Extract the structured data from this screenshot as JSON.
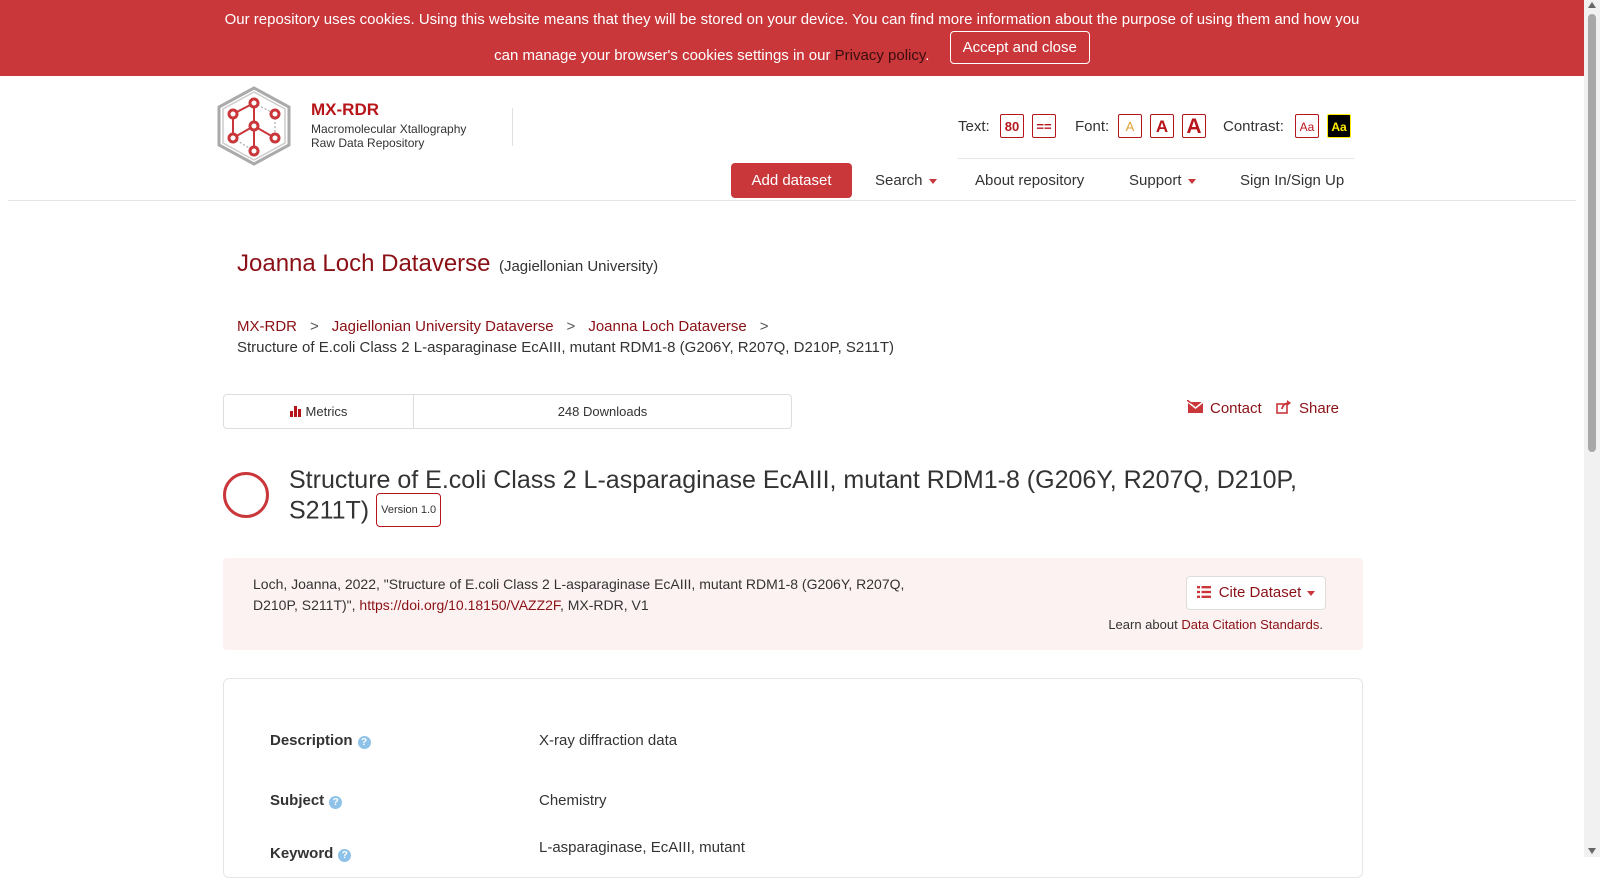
{
  "cookie_banner": {
    "text_line1": "Our repository uses cookies. Using this website means that they will be stored on your device. You can find more information about the purpose of using them and how you",
    "text_line2": "can manage your browser's cookies settings in our",
    "privacy_link": "Privacy policy",
    "period": ".",
    "accept_label": "Accept and close"
  },
  "header": {
    "brand_name": "MX-RDR",
    "brand_sub1": "Macromolecular Xtallography",
    "brand_sub2": "Raw Data Repository"
  },
  "accessibility": {
    "text_label": "Text:",
    "text_btn1": "80",
    "text_btn2": "==",
    "font_label": "Font:",
    "font_btn": "A",
    "contrast_label": "Contrast:",
    "contrast_btn": "Aa"
  },
  "nav": {
    "add_dataset": "Add dataset",
    "search": "Search",
    "about": "About repository",
    "support": "Support",
    "sign_in": "Sign In/Sign Up"
  },
  "dataverse": {
    "name": "Joanna Loch Dataverse",
    "affiliation": "(Jagiellonian University)"
  },
  "breadcrumb": {
    "items": [
      "MX-RDR",
      "Jagiellonian University Dataverse",
      "Joanna Loch Dataverse"
    ],
    "separator": ">",
    "current": "Structure of E.coli Class 2 L-asparaginase EcAIII, mutant RDM1-8 (G206Y, R207Q, D210P, S211T)"
  },
  "metrics": {
    "label": "Metrics",
    "downloads": "248 Downloads"
  },
  "actions": {
    "contact": "Contact",
    "share": "Share"
  },
  "dataset": {
    "title": "Structure of E.coli Class 2 L-asparaginase EcAIII, mutant RDM1-8 (G206Y, R207Q, D210P, S211T)",
    "version": "Version 1.0"
  },
  "citation": {
    "text_prefix": "Loch, Joanna, 2022, \"Structure of E.coli Class 2 L-asparaginase EcAIII, mutant RDM1-8 (G206Y, R207Q, D210P, S211T)\",",
    "doi": "https://doi.org/10.18150/VAZZ2F",
    "text_suffix": ", MX-RDR, V1",
    "cite_button": "Cite Dataset",
    "learn_prefix": "Learn about",
    "learn_link": "Data Citation Standards",
    "learn_period": "."
  },
  "metadata": {
    "rows": [
      {
        "key": "Description",
        "value": "X-ray diffraction data"
      },
      {
        "key": "Subject",
        "value": "Chemistry"
      },
      {
        "key": "Keyword",
        "value": "L-asparaginase, EcAIII, mutant"
      }
    ],
    "help_glyph": "?"
  },
  "colors": {
    "brand_red": "#c9373b",
    "link_red": "#8b1015",
    "citation_bg": "#fdf2f2",
    "help_blue": "#8ec2e8"
  }
}
